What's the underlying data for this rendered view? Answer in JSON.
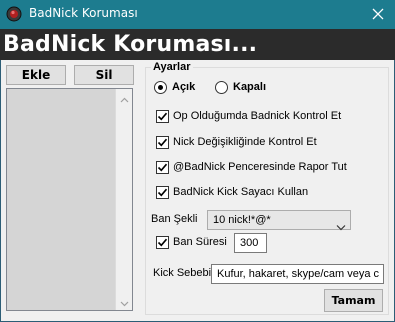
{
  "window": {
    "title": "BadNick Koruması",
    "close_glyph": "✕"
  },
  "banner": {
    "text": "BadNick Koruması..."
  },
  "list_panel": {
    "add_label": "Ekle",
    "remove_label": "Sil"
  },
  "settings": {
    "group_title": "Ayarlar",
    "radio_on": {
      "label": "Açık",
      "selected": true
    },
    "radio_off": {
      "label": "Kapalı",
      "selected": false
    },
    "checks": [
      {
        "label": "Op Olduğumda Badnick Kontrol Et",
        "checked": true
      },
      {
        "label": "Nick Değişikliğinde Kontrol Et",
        "checked": true
      },
      {
        "label": "@BadNick Penceresinde Rapor Tut",
        "checked": true
      },
      {
        "label": "BadNick Kick Sayacı Kullan",
        "checked": true
      }
    ],
    "ban_type": {
      "label": "Ban Şekli",
      "value": "10 nick!*@*"
    },
    "ban_duration": {
      "label": "Ban Süresi",
      "checked": true,
      "value": "300"
    },
    "kick_reason": {
      "label": "Kick Sebebi",
      "value": "Kufur, hakaret, skype/cam veya c"
    },
    "ok_label": "Tamam"
  },
  "colors": {
    "titlebar": "#1d7c8f",
    "banner": "#2b2b2b",
    "window_bg": "#f0f0f0",
    "list_bg": "#d5d5d5"
  }
}
